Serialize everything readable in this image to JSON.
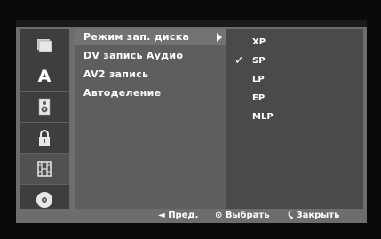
{
  "menu": {
    "items": [
      {
        "label": "Режим зап. диска"
      },
      {
        "label": "DV запись Аудио"
      },
      {
        "label": "AV2 запись"
      },
      {
        "label": "Автоделение"
      }
    ]
  },
  "submenu": {
    "options": [
      "XP",
      "SP",
      "LP",
      "EP",
      "MLP"
    ],
    "selected": "SP",
    "check_glyph": "✓"
  },
  "sidebar": {
    "icons": [
      "disc-icon",
      "language-icon",
      "audio-icon",
      "lock-icon",
      "recording-film-icon",
      "dvd-disc-icon"
    ],
    "active": "recording-film-icon"
  },
  "footer": {
    "prev": {
      "glyph": "◄",
      "label": "Пред."
    },
    "select": {
      "glyph": "⊙",
      "label": "Выбрать"
    },
    "close": {
      "glyph": "⤹",
      "label": "Закрыть"
    }
  },
  "colors": {
    "frame": "#6d6d6d",
    "menu_bg": "#5e5e5e",
    "submenu_bg": "#4a4a4a",
    "highlight": "#737373"
  }
}
